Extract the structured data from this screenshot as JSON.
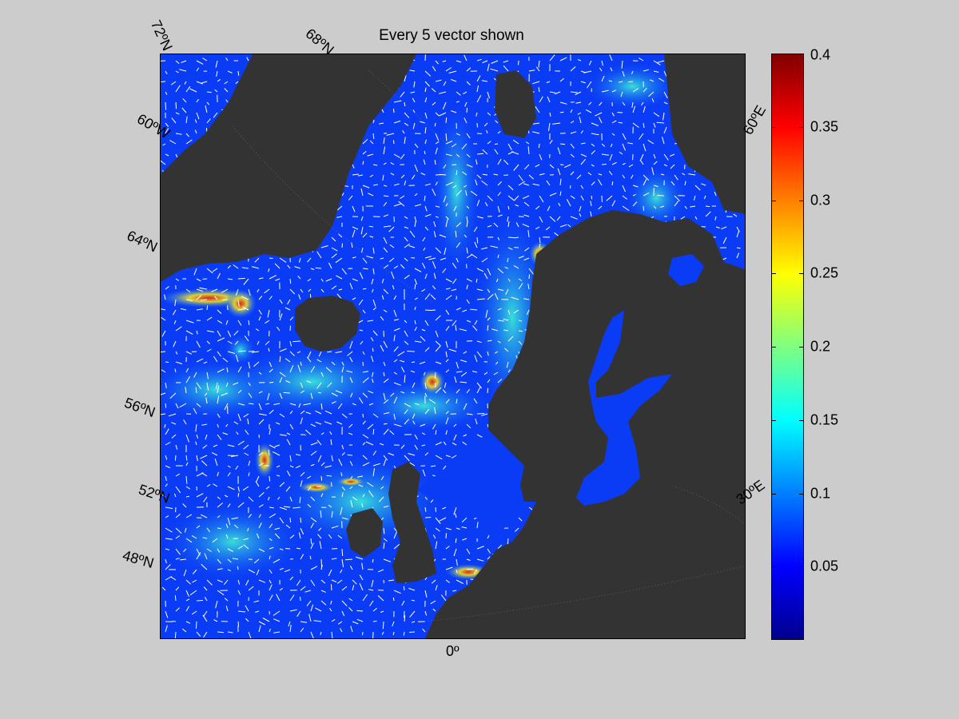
{
  "figure": {
    "title": "Every 5 vector shown",
    "map": {
      "projection": "polar stereographic (north)",
      "latitude_labels": [
        "72ºN",
        "68ºN",
        "64ºN",
        "56ºN",
        "52ºN",
        "48ºN"
      ],
      "longitude_labels": [
        "60ºW",
        "0º",
        "30ºE",
        "60ºE"
      ],
      "land_color": "#333333",
      "field_variable": "current speed",
      "vector_color": "#ffffff",
      "vector_subsampling": 5
    },
    "colorbar": {
      "colormap": "jet",
      "min": 0,
      "max": 0.4,
      "tick_labels": [
        "0.4",
        "0.35",
        "0.3",
        "0.25",
        "0.2",
        "0.15",
        "0.1",
        "0.05"
      ],
      "tick_values": [
        0.4,
        0.35,
        0.3,
        0.25,
        0.2,
        0.15,
        0.1,
        0.05
      ]
    }
  }
}
